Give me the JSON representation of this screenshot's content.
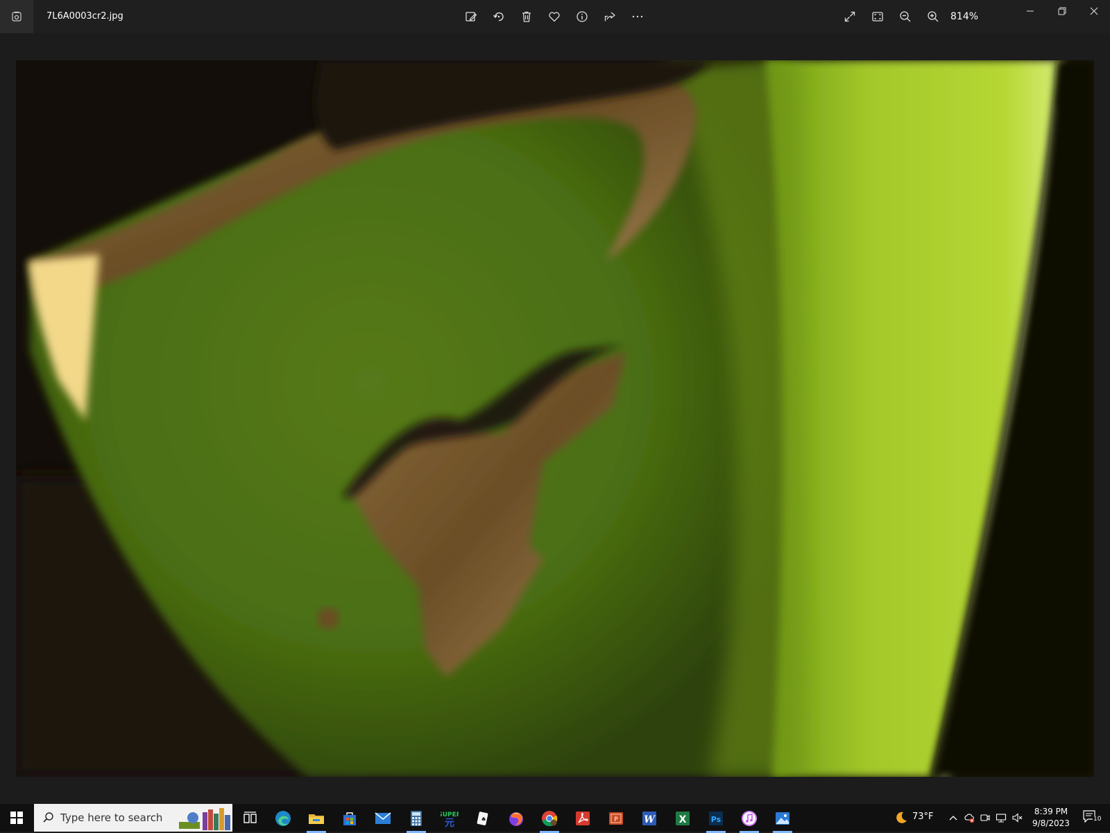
{
  "titlebar": {
    "file_name": "7L6A0003cr2.jpg",
    "zoom_level": "814%",
    "toolbar_icons": [
      "edit-image-icon",
      "rotate-icon",
      "delete-icon",
      "favorite-icon",
      "info-icon",
      "share-icon",
      "more-icon"
    ],
    "view_icons": [
      "fullscreen-icon",
      "fit-window-icon",
      "zoom-out-icon",
      "zoom-in-icon"
    ],
    "window_controls": [
      "minimize-icon",
      "restore-icon",
      "close-icon"
    ]
  },
  "photo": {
    "description_colors": {
      "dark": "#120d08",
      "leaf": "#5a7a10",
      "bright_leaf": "#a8cc28",
      "brown": "#7a5a2e"
    }
  },
  "taskbar": {
    "search_placeholder": "Type here to search",
    "pinned_apps": [
      "task-view",
      "edge",
      "file-explorer",
      "store",
      "mail",
      "calculator",
      "super",
      "solitaire",
      "firefox",
      "chrome",
      "acrobat",
      "powerpoint",
      "word",
      "excel",
      "photoshop",
      "itunes",
      "photos"
    ],
    "weather_temp": "73°F",
    "clock_time": "8:39 PM",
    "clock_date": "9/8/2023",
    "notification_count": "10",
    "accent": "#7fb8ff"
  }
}
